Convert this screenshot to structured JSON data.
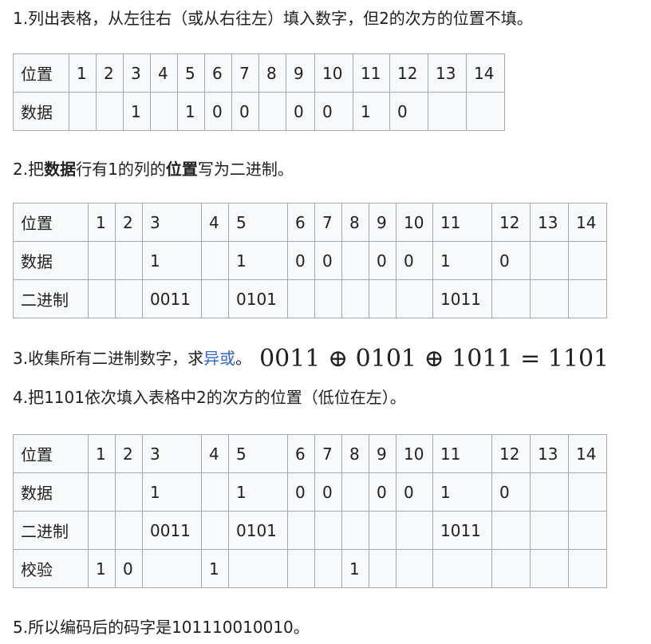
{
  "step1": "1.列出表格，从左往右（或从右往左）填入数字，但2的次方的位置不填。",
  "step2": {
    "prefix": "2.把",
    "bold1": "数据",
    "mid": "行有1的列的",
    "bold2": "位置",
    "suffix": "写为二进制。"
  },
  "step3": {
    "prefix": "3.收集所有二进制数字，求",
    "link": "异或",
    "suffix": "。",
    "formula": "0011 ⊕ 0101 ⊕ 1011 = 1101"
  },
  "step4": "4.把1101依次填入表格中2的次方的位置（低位在左）。",
  "step5": "5.所以编码后的码字是101110010010。",
  "table1": {
    "rows": [
      [
        "位置",
        "1",
        "2",
        "3",
        "4",
        "5",
        "6",
        "7",
        "8",
        "9",
        "10",
        "11",
        "12",
        "13",
        "14"
      ],
      [
        "数据",
        "",
        "",
        "1",
        "",
        "1",
        "0",
        "0",
        "",
        "0",
        "0",
        "1",
        "0",
        "",
        ""
      ]
    ]
  },
  "table2": {
    "rows": [
      [
        "位置",
        "1",
        "2",
        "3",
        "4",
        "5",
        "6",
        "7",
        "8",
        "9",
        "10",
        "11",
        "12",
        "13",
        "14"
      ],
      [
        "数据",
        "",
        "",
        "1",
        "",
        "1",
        "0",
        "0",
        "",
        "0",
        "0",
        "1",
        "0",
        "",
        ""
      ],
      [
        "二进制",
        "",
        "",
        "0011",
        "",
        "0101",
        "",
        "",
        "",
        "",
        "",
        "1011",
        "",
        "",
        ""
      ]
    ]
  },
  "table3": {
    "rows": [
      [
        "位置",
        "1",
        "2",
        "3",
        "4",
        "5",
        "6",
        "7",
        "8",
        "9",
        "10",
        "11",
        "12",
        "13",
        "14"
      ],
      [
        "数据",
        "",
        "",
        "1",
        "",
        "1",
        "0",
        "0",
        "",
        "0",
        "0",
        "1",
        "0",
        "",
        ""
      ],
      [
        "二进制",
        "",
        "",
        "0011",
        "",
        "0101",
        "",
        "",
        "",
        "",
        "",
        "1011",
        "",
        "",
        ""
      ],
      [
        "校验",
        "1",
        "0",
        "",
        "1",
        "",
        "",
        "",
        "1",
        "",
        "",
        "",
        "",
        "",
        ""
      ]
    ]
  }
}
